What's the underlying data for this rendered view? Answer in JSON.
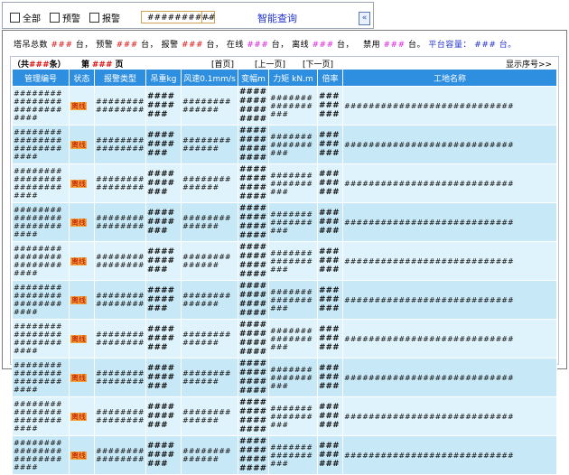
{
  "toolbar": {
    "checkbox_all": "全部",
    "checkbox_warn": "预警",
    "checkbox_alarm": "报警",
    "select_value": "##########",
    "smart_query": "智能查询",
    "collapse_icon": "«"
  },
  "stats": {
    "total_label": "塔吊总数",
    "total": "###",
    "unit": "台，",
    "warn_label": "预警",
    "warn": "###",
    "alarm_label": "报警",
    "alarm": "###",
    "online_label": "在线",
    "online": "###",
    "offline_label": "离线",
    "offline": "###",
    "disabled_label": "禁用",
    "disabled": "###",
    "unit_period": "台。",
    "platform_label": "平台容量：",
    "platform": "###",
    "platform_unit": "台。"
  },
  "pager": {
    "total_prefix": "（共",
    "total": "###",
    "total_suffix": "条）",
    "page_prefix": "第",
    "page": "###",
    "page_suffix": "页",
    "first": "[首页]",
    "prev": "[上一页]",
    "next": "[下一页]",
    "show_index": "显示序号>>"
  },
  "table": {
    "headers": [
      "管理编号",
      "状态",
      "报警类型",
      "吊重kg",
      "风速0.1mm/s",
      "变幅m",
      "力矩 kN.m",
      "倍率",
      "工地名称"
    ],
    "rows": [
      {
        "id": "############################",
        "status": "离线",
        "alarm": "################",
        "weight": "###########",
        "wind": "##############",
        "amp": "################",
        "torque": "#################",
        "ratio": "#########",
        "site": "############################"
      },
      {
        "id": "############################",
        "status": "离线",
        "alarm": "################",
        "weight": "###########",
        "wind": "##############",
        "amp": "################",
        "torque": "#################",
        "ratio": "#########",
        "site": "############################"
      },
      {
        "id": "############################",
        "status": "离线",
        "alarm": "################",
        "weight": "###########",
        "wind": "##############",
        "amp": "################",
        "torque": "#################",
        "ratio": "#########",
        "site": "############################"
      },
      {
        "id": "############################",
        "status": "离线",
        "alarm": "################",
        "weight": "###########",
        "wind": "##############",
        "amp": "################",
        "torque": "#################",
        "ratio": "#########",
        "site": "############################"
      },
      {
        "id": "############################",
        "status": "离线",
        "alarm": "################",
        "weight": "###########",
        "wind": "##############",
        "amp": "################",
        "torque": "#################",
        "ratio": "#########",
        "site": "############################"
      },
      {
        "id": "############################",
        "status": "离线",
        "alarm": "################",
        "weight": "###########",
        "wind": "##############",
        "amp": "################",
        "torque": "#################",
        "ratio": "#########",
        "site": "############################"
      },
      {
        "id": "############################",
        "status": "离线",
        "alarm": "################",
        "weight": "###########",
        "wind": "##############",
        "amp": "################",
        "torque": "#################",
        "ratio": "#########",
        "site": "############################"
      },
      {
        "id": "############################",
        "status": "离线",
        "alarm": "################",
        "weight": "###########",
        "wind": "##############",
        "amp": "################",
        "torque": "#################",
        "ratio": "#########",
        "site": "############################"
      },
      {
        "id": "############################",
        "status": "离线",
        "alarm": "################",
        "weight": "###########",
        "wind": "##############",
        "amp": "################",
        "torque": "#################",
        "ratio": "#########",
        "site": "############################"
      },
      {
        "id": "############################",
        "status": "离线",
        "alarm": "################",
        "weight": "###########",
        "wind": "##############",
        "amp": "################",
        "torque": "#################",
        "ratio": "#########",
        "site": "############################"
      }
    ]
  }
}
